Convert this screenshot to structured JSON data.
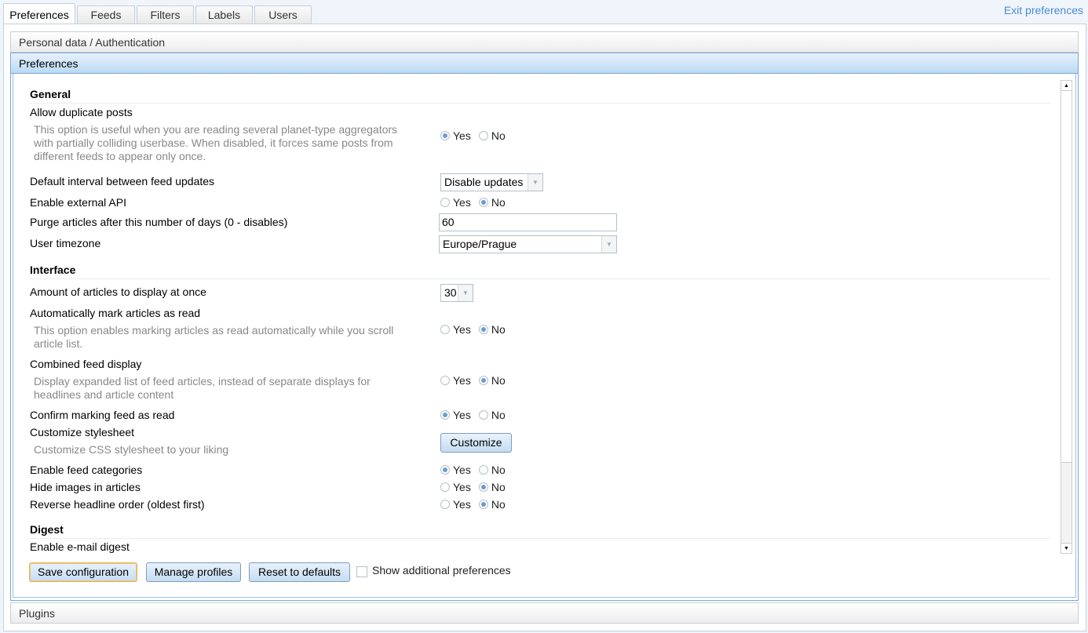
{
  "tabs": [
    "Preferences",
    "Feeds",
    "Filters",
    "Labels",
    "Users"
  ],
  "exit_link": "Exit preferences",
  "accordion": {
    "personal": "Personal data / Authentication",
    "preferences": "Preferences",
    "plugins": "Plugins"
  },
  "yes": "Yes",
  "no": "No",
  "general": {
    "title": "General",
    "dup_label": "Allow duplicate posts",
    "dup_desc": [
      "This option is useful when you are reading several planet-type aggregators",
      "with partially colliding userbase. When disabled, it forces same posts from",
      "different feeds to appear only once."
    ],
    "dup_value": "Yes",
    "interval_label": "Default interval between feed updates",
    "interval_value": "Disable updates",
    "api_label": "Enable external API",
    "api_value": "No",
    "purge_label": "Purge articles after this number of days (0 - disables)",
    "purge_value": "60",
    "tz_label": "User timezone",
    "tz_value": "Europe/Prague"
  },
  "interface": {
    "title": "Interface",
    "amount_label": "Amount of articles to display at once",
    "amount_value": "30",
    "automark_label": "Automatically mark articles as read",
    "automark_desc": [
      "This option enables marking articles as read automatically while you scroll",
      "article list."
    ],
    "automark_value": "No",
    "combined_label": "Combined feed display",
    "combined_desc": [
      "Display expanded list of feed articles, instead of separate displays for",
      "headlines and article content"
    ],
    "combined_value": "No",
    "confirm_label": "Confirm marking feed as read",
    "confirm_value": "Yes",
    "css_label": "Customize stylesheet",
    "css_desc": "Customize CSS stylesheet to your liking",
    "css_button": "Customize",
    "cats_label": "Enable feed categories",
    "cats_value": "Yes",
    "hideimg_label": "Hide images in articles",
    "hideimg_value": "No",
    "reverse_label": "Reverse headline order (oldest first)",
    "reverse_value": "No"
  },
  "digest": {
    "title": "Digest",
    "enable_label": "Enable e-mail digest"
  },
  "footer": {
    "save": "Save configuration",
    "profiles": "Manage profiles",
    "reset": "Reset to defaults",
    "show_additional": "Show additional preferences",
    "show_additional_checked": false
  }
}
